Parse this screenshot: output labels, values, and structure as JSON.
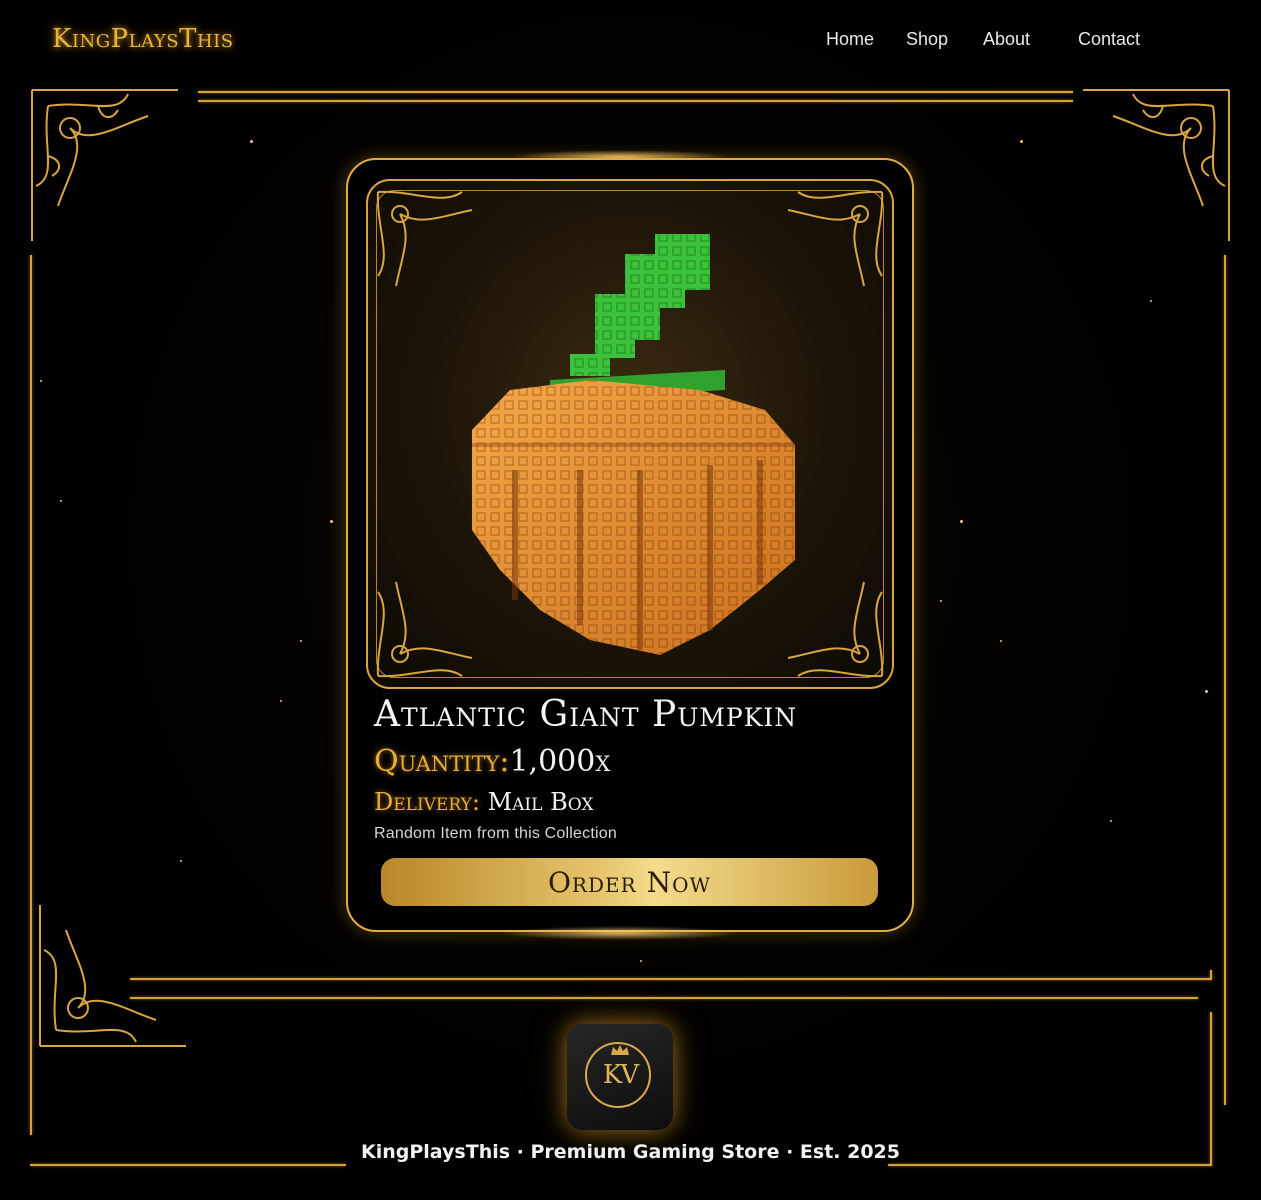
{
  "header": {
    "brand": "KingPlaysThis",
    "nav": [
      {
        "label": "Home"
      },
      {
        "label": "Shop"
      },
      {
        "label": "About"
      },
      {
        "label": "Contact"
      }
    ]
  },
  "product": {
    "title": "Atlantic Giant Pumpkin",
    "quantity_label": "Quantity:",
    "quantity_value": "1,000x",
    "delivery_label": "Delivery:",
    "delivery_value": "Mail Box",
    "note": "Random Item from this Collection",
    "order_label": "Order Now",
    "image_icon": "voxel-pumpkin-icon"
  },
  "footer": {
    "logo_text": "KV",
    "tagline": "KingPlaysThis · Premium Gaming Store · Est. 2025"
  },
  "colors": {
    "accent_gold": "#e0ad42",
    "background": "#000000",
    "pumpkin_orange": "#e8892b",
    "stem_green": "#3cc23a"
  }
}
